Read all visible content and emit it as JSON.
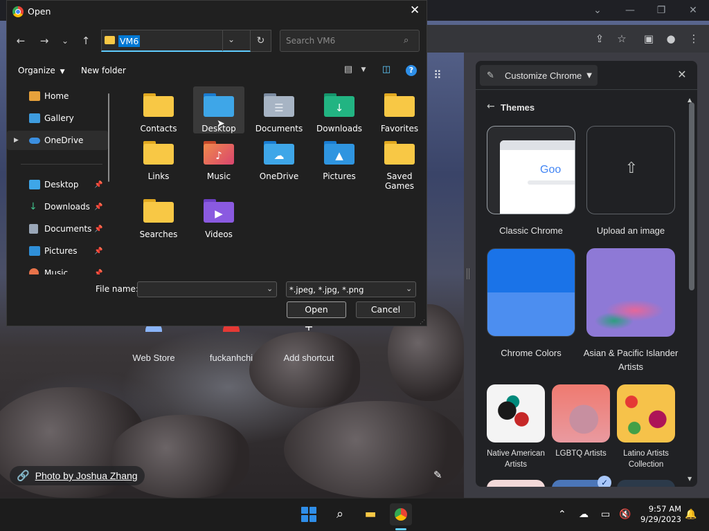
{
  "dialog": {
    "title": "Open",
    "address": "VM6",
    "search_placeholder": "Search VM6",
    "organize_label": "Organize",
    "new_folder_label": "New folder",
    "nav_items": [
      {
        "label": "Home"
      },
      {
        "label": "Gallery"
      },
      {
        "label": "OneDrive"
      },
      {
        "label": "Desktop"
      },
      {
        "label": "Downloads"
      },
      {
        "label": "Documents"
      },
      {
        "label": "Pictures"
      },
      {
        "label": "Music"
      }
    ],
    "files": [
      {
        "label": "Contacts"
      },
      {
        "label": "Desktop"
      },
      {
        "label": "Documents"
      },
      {
        "label": "Downloads"
      },
      {
        "label": "Favorites"
      },
      {
        "label": "Links"
      },
      {
        "label": "Music"
      },
      {
        "label": "OneDrive"
      },
      {
        "label": "Pictures"
      },
      {
        "label": "Saved Games"
      },
      {
        "label": "Searches"
      },
      {
        "label": "Videos"
      }
    ],
    "file_name_label": "File name:",
    "file_name_value": "",
    "file_type": "*.jpeg, *.jpg, *.png",
    "open_label": "Open",
    "cancel_label": "Cancel",
    "colors": {
      "accent": "#0078d4",
      "folder": "#f8c845"
    }
  },
  "new_tab": {
    "shortcuts": [
      {
        "label": "Web Store"
      },
      {
        "label": "fuckanhchi"
      },
      {
        "label": "Add shortcut"
      }
    ],
    "photo_credit": "Photo by Joshua Zhang"
  },
  "panel": {
    "select_label": "Customize Chrome",
    "section_title": "Themes",
    "themes": [
      {
        "label": "Classic Chrome"
      },
      {
        "label": "Upload an image"
      },
      {
        "label": "Chrome Colors"
      },
      {
        "label": "Asian & Pacific Islander Artists"
      },
      {
        "label": "Native American Artists"
      },
      {
        "label": "LGBTQ Artists"
      },
      {
        "label": "Latino Artists Collection"
      }
    ],
    "classic_preview_text": "Goo"
  },
  "taskbar": {
    "time": "9:57 AM",
    "date": "9/29/2023"
  }
}
